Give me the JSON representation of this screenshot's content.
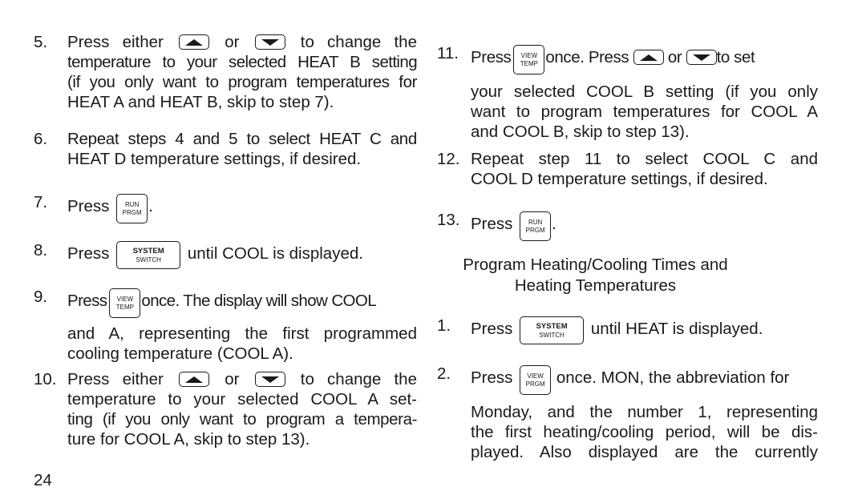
{
  "page_number": "24",
  "keys": {
    "up": "up-arrow",
    "down": "down-arrow",
    "run_prgm": [
      "RUN",
      "PRGM"
    ],
    "system_switch": [
      "SYSTEM",
      "SWITCH"
    ],
    "view_temp": [
      "VIEW",
      "TEMP"
    ],
    "view_prgm": [
      "VIEW",
      "PRGM"
    ]
  },
  "left": {
    "step5": {
      "num": "5.",
      "l1a": "Press either",
      "l1b": "or",
      "l1c": "to change the",
      "l2": "temperature to your selected HEAT B setting",
      "l3": "(if you only want to program temperatures for",
      "l4": "HEAT A and HEAT B, skip to step 7)."
    },
    "step6": {
      "num": "6.",
      "l1": "Repeat steps 4 and 5 to select HEAT C and",
      "l2": "HEAT D temperature settings, if desired."
    },
    "step7": {
      "num": "7.",
      "a": "Press",
      "b": "."
    },
    "step8": {
      "num": "8.",
      "a": "Press",
      "b": "until COOL is displayed."
    },
    "step9": {
      "num": "9.",
      "a": "Press",
      "b": "once. The display will show COOL",
      "l2": "and A, representing the first programmed",
      "l3": "cooling temperature (COOL A)."
    },
    "step10": {
      "num": "10.",
      "l1a": "Press either",
      "l1b": "or",
      "l1c": "to change the",
      "l2": "temperature to your selected COOL A set-",
      "l3": "ting (if you only want to program a tempera-",
      "l4": "ture for COOL A, skip to step 13)."
    }
  },
  "right": {
    "step11": {
      "num": "11.",
      "a": "Press",
      "b": "once. Press",
      "c": "or",
      "d": "to set",
      "l2": "your selected COOL B setting (if you only",
      "l3": "want to program temperatures for COOL A",
      "l4": "and COOL B, skip to step 13)."
    },
    "step12": {
      "num": "12.",
      "l1": "Repeat step 11 to select COOL C and",
      "l2": "COOL D temperature settings, if desired."
    },
    "step13": {
      "num": "13.",
      "a": "Press",
      "b": "."
    },
    "heading": {
      "l1": "Program Heating/Cooling Times and",
      "l2": "Heating Temperatures"
    },
    "stepH1": {
      "num": "1.",
      "a": "Press",
      "b": "until HEAT is displayed."
    },
    "stepH2": {
      "num": "2.",
      "a": "Press",
      "b": "once. MON, the abbreviation for",
      "l2": "Monday, and the number 1, representing",
      "l3": "the first heating/cooling period, will be dis-",
      "l4": "played. Also displayed are the currently"
    }
  }
}
